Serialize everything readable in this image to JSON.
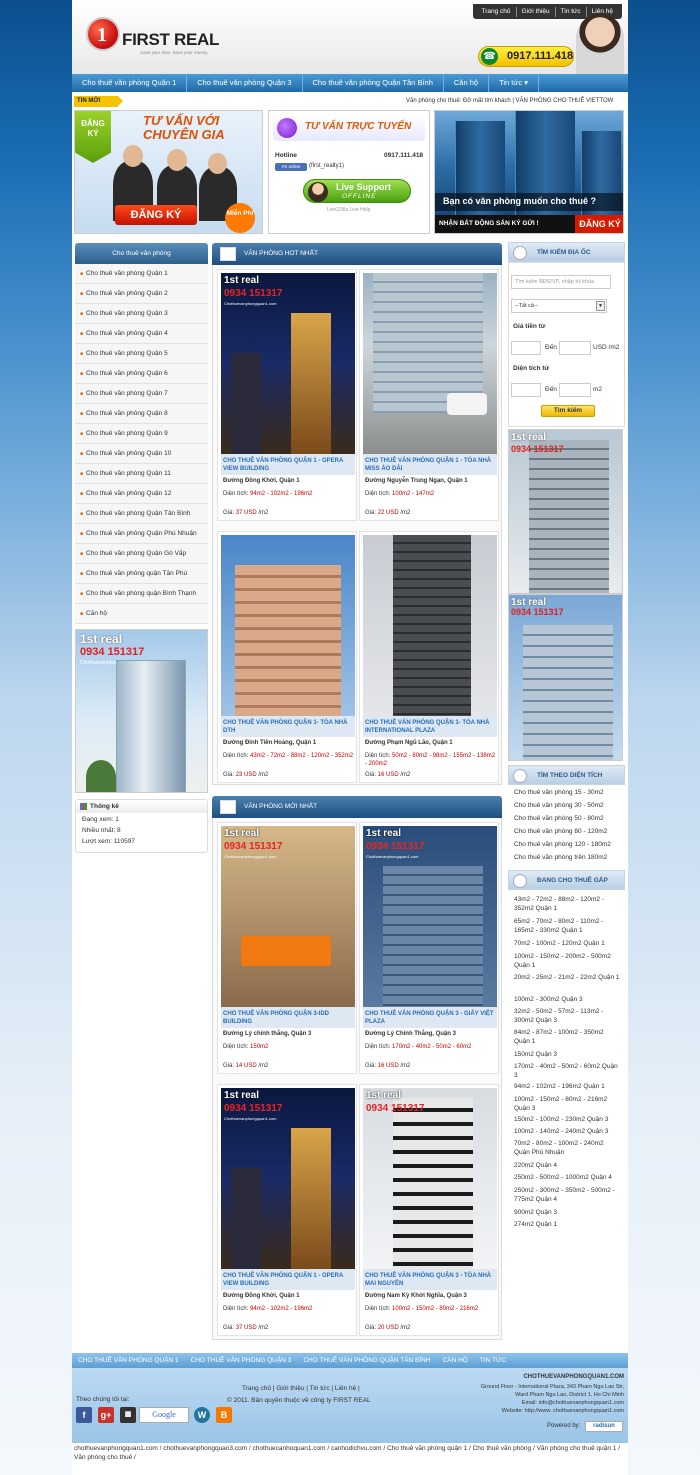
{
  "header": {
    "logo_mark": "1",
    "logo_text": "FIRST REAL",
    "logo_sub": "Save your time. Save your money.",
    "top_links": [
      "Trang chủ",
      "Giới thiệu",
      "Tin tức",
      "Liên hệ"
    ],
    "hotline": "0917.111.418"
  },
  "nav": [
    "Cho thuê văn phòng Quận 1",
    "Cho thuê văn phòng Quận 3",
    "Cho thuê văn phòng Quận Tân Bình",
    "Căn hộ",
    "Tin tức ▾"
  ],
  "ticker": {
    "label": "TIN MỚI",
    "text": "Văn phòng cho thuê: Đỡ mất tìm khách    |    VĂN PHÒNG CHO THUÊ VIETTOW"
  },
  "banner1": {
    "tag": "ĐĂNG KÝ",
    "title": "TƯ VẤN VỚI CHUYÊN GIA",
    "button": "ĐĂNG KÝ",
    "free": "Miễn Phí"
  },
  "banner2": {
    "title": "TƯ VẤN TRỰC TUYẾN",
    "hotline_label": "Hotline",
    "hotline": "0917.111.418",
    "badge": "I'm online",
    "skype": "(first_realty1)",
    "live1": "Live Support",
    "live2": "OFFLINE",
    "foot": "Live2Zilla Live Help"
  },
  "banner3": {
    "question": "Bạn có văn phòng muốn cho thuê ?",
    "bar": "NHẬN BẤT ĐỘNG SẢN KÝ GỬI !",
    "button": "ĐĂNG KÝ"
  },
  "left": {
    "heading": "Cho thuê văn phòng",
    "categories": [
      "Cho thuê văn phòng Quận 1",
      "Cho thuê văn phòng Quận 2",
      "Cho thuê văn phòng Quận 3",
      "Cho thuê văn phòng Quận 4",
      "Cho thuê văn phòng Quận 5",
      "Cho thuê văn phòng Quận 6",
      "Cho thuê văn phòng Quận 7",
      "Cho thuê văn phòng Quận 8",
      "Cho thuê văn phòng Quận 9",
      "Cho thuê văn phòng Quận 10",
      "Cho thuê văn phòng Quận 11",
      "Cho thuê văn phòng Quận 12",
      "Cho thuê văn phòng Quận Tân Bình",
      "Cho thuê văn phòng Quận Phú Nhuận",
      "Cho thuê văn phòng Quận Gò Vấp",
      "Cho thuê văn phòng quận Tân Phú",
      "Cho thuê văn phòng quận Bình Thạnh",
      "Căn hộ"
    ],
    "stats_title": "Thống kê",
    "stats": [
      "Đang xem: 1",
      "Nhiều nhất: 8",
      "Lượt xem: 110597"
    ]
  },
  "ad": {
    "brand": "1st real",
    "phone": "0934 151317",
    "site": "Chothuevanphongquan1.com"
  },
  "hot": {
    "title": "VĂN PHÒNG HOT NHẤT",
    "cards": [
      {
        "title": "CHO THUÊ VĂN PHÒNG QUẬN 1 - OPERA VIEW BUILDING",
        "address": "Đường Đồng Khởi, Quận 1",
        "area_label": "Diện tích:",
        "area": "94m2 - 102m2 - 196m2",
        "price_label": "Giá:",
        "price": "37 USD",
        "unit": "/m2"
      },
      {
        "title": "CHO THUÊ VĂN PHÒNG QUẬN 1 - TÒA NHÀ MISS ÁO DÀI",
        "address": "Đường Nguyễn Trung Ngạn, Quận 1",
        "area_label": "Diện tích:",
        "area": "100m2 - 147m2",
        "price_label": "Giá:",
        "price": "22 USD",
        "unit": "/m2"
      },
      {
        "title": "CHO THUÊ VĂN PHÒNG QUẬN 1- TÒA NHÀ DTH",
        "address": "Đường Đinh Tiên Hoàng, Quận 1",
        "area_label": "Diện tích:",
        "area": "43m2 - 72m2 - 88m2 - 120m2 - 352m2",
        "price_label": "Giá:",
        "price": "23 USD",
        "unit": "/m2"
      },
      {
        "title": "CHO THUÊ VĂN PHÒNG QUẬN 1- TÒA NHÀ INTERNATIONAL PLAZA",
        "address": "Đường Phạm Ngũ Lão, Quận 1",
        "area_label": "Diện tích:",
        "area": "50m2 - 80m2 - 98m2 - 155m2 - 138m2 - 200m2",
        "price_label": "Giá:",
        "price": "16 USD",
        "unit": "/m2"
      }
    ]
  },
  "new": {
    "title": "VĂN PHÒNG MỚI NHẤT",
    "cards": [
      {
        "title": "CHO THUÊ VĂN PHÒNG QUẬN 3-IDD BUILDING",
        "address": "Đường Lý chính thắng, Quận 3",
        "area_label": "Diện tích:",
        "area": "150m2",
        "price_label": "Giá:",
        "price": "14 USD",
        "unit": "/m2"
      },
      {
        "title": "CHO THUÊ VĂN PHÒNG QUẬN 3 - GIẤY VIỆT PLAZA",
        "address": "Đường Lý Chính Thắng, Quận 3",
        "area_label": "Diện tích:",
        "area": "170m2 - 40m2 - 50m2 - 60m2",
        "price_label": "Giá:",
        "price": "16 USD",
        "unit": "/m2"
      },
      {
        "title": "CHO THUÊ VĂN PHÒNG QUẬN 1 - OPERA VIEW BUILDING",
        "address": "Đường Đồng Khởi, Quận 1",
        "area_label": "Diện tích:",
        "area": "94m2 - 102m2 - 196m2",
        "price_label": "Giá:",
        "price": "37 USD",
        "unit": "/m2"
      },
      {
        "title": "CHO THUÊ VĂN PHÒNG QUẬN 3 - TÒA NHÀ MAI NGUYÊN",
        "address": "Đường Nam Kỳ Khởi Nghĩa, Quận 3",
        "area_label": "Diện tích:",
        "area": "100m2 - 150m2 - 80m2 - 216m2",
        "price_label": "Giá:",
        "price": "20 USD",
        "unit": "/m2"
      }
    ]
  },
  "search": {
    "title": "TÌM KIẾM ĐỊA ỐC",
    "placeholder": "Tìm kiếm BĐS/VP, nhập từ khóa",
    "select": "--Tất cả--",
    "price_label": "Giá tiền từ",
    "to": "Đến",
    "price_unit": "USD /m2",
    "area_label": "Diện tích từ",
    "area_unit": "m2",
    "button": "Tìm kiếm"
  },
  "area_filter": {
    "title": "TÌM THEO DIỆN TÍCH",
    "items": [
      "Cho thuê văn phòng 15 - 30m2",
      "Cho thuê văn phòng 30 - 50m2",
      "Cho thuê văn phòng 50 - 80m2",
      "Cho thuê văn phòng 80 - 120m2",
      "Cho thuê văn phòng 120 - 180m2",
      "Cho thuê văn phòng trên 180m2"
    ]
  },
  "urgent": {
    "title": "ĐANG CHO THUÊ GẤP",
    "items": [
      "43m2 - 72m2 - 88m2 - 120m2 - 352m2 Quận 1",
      "65m2 - 70m2 - 80m2 - 110m2 - 165m2 - 330m2 Quận 1",
      "70m2 - 100m2 - 120m2 Quận 1",
      "100m2 - 150m2 - 200m2 - 500m2 Quận 1",
      "20m2 - 25m2 - 21m2 - 22m2 Quận 1",
      "100m2 - 300m2 Quận 3",
      "32m2 - 50m2 - 57m2 - 113m2 - 300m2 Quận 3",
      "84m2 - 87m2 - 100m2 - 350m2 Quận 1",
      "150m2 Quận 3",
      "170m2 - 40m2 - 50m2 - 60m2 Quận 3",
      "94m2 - 102m2 - 196m2 Quận 1",
      "100m2 - 150m2 - 80m2 - 216m2 Quận 3",
      "150m2 - 100m2 - 230m2 Quận 3",
      "100m2 - 140m2 - 240m2 Quận 3",
      "70m2 - 80m2 - 100m2 - 240m2 Quận Phú Nhuận",
      "220m2 Quận 4",
      "250m2 - 500m2 - 1000m2 Quận 4",
      "250m2 - 300m2 - 350m2 - 500m2 - 775m2 Quận 4",
      "900m2 Quận 3",
      "274m2 Quận 1"
    ]
  },
  "footer": {
    "nav": [
      "CHO THUÊ VĂN PHÒNG QUẬN 1",
      "CHO THUÊ VĂN PHÒNG QUẬN 3",
      "CHO THUÊ VĂN PHÒNG QUẬN TÂN BÌNH",
      "CĂN HỘ",
      "TIN TỨC"
    ],
    "links": "Trang chủ   |   Giới thiệu   |   Tin tức   |   Liên hệ   |",
    "copyright": "© 2011. Bản quyền thuộc về công ty FIRST REAL",
    "follow": "Theo chúng tôi tại:",
    "gsites": "Google",
    "site_name": "CHOTHUEVANPHONGQUAN1.COM",
    "address1": "Ground Floor - International Plaza, 343 Pham Ngu Lao Str,",
    "address2": "Ward Pham Ngu Lao, District 1, Ho Chi Minh",
    "email": "Email: info@chothuevanphongquan1.com",
    "website": "Website: http://www. chothuevanphongquan1.com",
    "powered": "Powered by:",
    "powered_brand": "radisun",
    "bottom": "chothuevanphongquan1.com / chothuevanphongquan3.com / chothuecanhoquan1.com / canhodichvu.com / Cho thuê văn phòng quận 1 / Cho thuê văn phòng / Văn phòng cho thuê quận 1 / Văn phòng cho thuê /"
  }
}
